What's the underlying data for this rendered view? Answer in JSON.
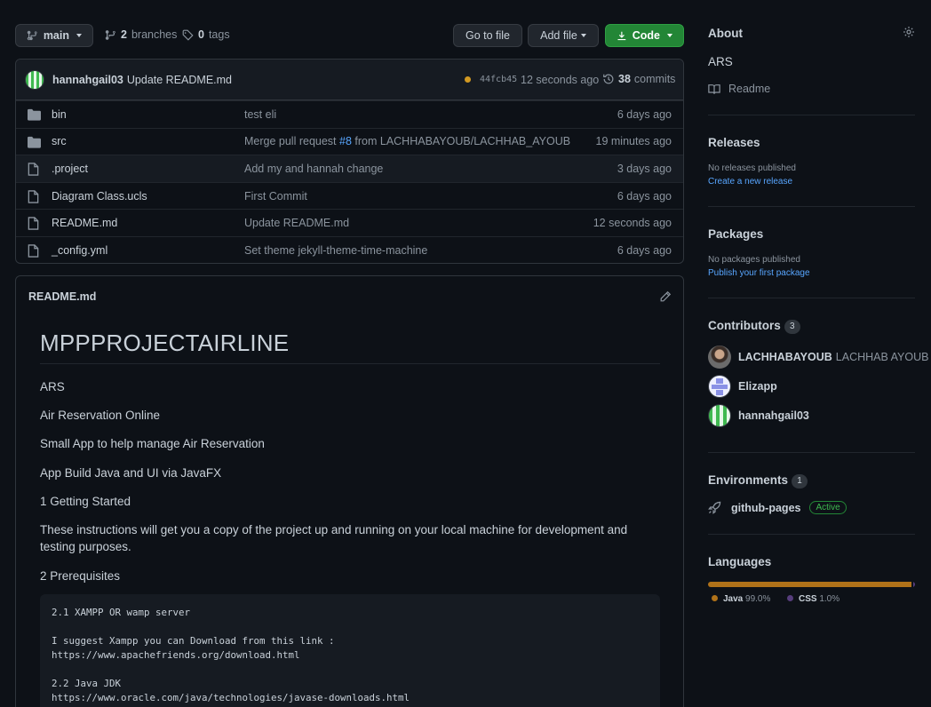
{
  "toolbar": {
    "branch": "main",
    "branches_count": "2",
    "branches_label": "branches",
    "tags_count": "0",
    "tags_label": "tags",
    "go_to_file": "Go to file",
    "add_file": "Add file",
    "code": "Code"
  },
  "latest_commit": {
    "author": "hannahgail03",
    "message": "Update README.md",
    "sha": "44fcb45",
    "time": "12 seconds ago",
    "commits_count": "38",
    "commits_label": "commits",
    "status_color": "#d29922"
  },
  "files": [
    {
      "type": "folder",
      "name": "bin",
      "message": "test eli",
      "age": "6 days ago"
    },
    {
      "type": "folder",
      "name": "src",
      "message_pre": "Merge pull request ",
      "message_link": "#8",
      "message_post": " from LACHHABAYOUB/LACHHAB_AYOUB",
      "age": "19 minutes ago"
    },
    {
      "type": "file",
      "name": ".project",
      "message": "Add my and hannah change",
      "age": "3 days ago"
    },
    {
      "type": "file",
      "name": "Diagram Class.ucls",
      "message": "First Commit",
      "age": "6 days ago"
    },
    {
      "type": "file",
      "name": "README.md",
      "message": "Update README.md",
      "age": "12 seconds ago"
    },
    {
      "type": "file",
      "name": "_config.yml",
      "message": "Set theme jekyll-theme-time-machine",
      "age": "6 days ago"
    }
  ],
  "readme": {
    "filename": "README.md",
    "title": "MPPPROJECTAIRLINE",
    "paragraphs": [
      "ARS",
      "Air Reservation Online",
      "Small App to help manage Air Reservation",
      "App Build Java and UI via JavaFX",
      "1 Getting Started",
      "These instructions will get you a copy of the project up and running on your local machine for development and testing purposes.",
      "2 Prerequisites"
    ],
    "code_lines": [
      "2.1 XAMPP OR wamp server",
      "",
      "I suggest Xampp you can Download from this link :",
      "https://www.apachefriends.org/download.html",
      "",
      "2.2 Java JDK",
      "https://www.oracle.com/java/technologies/javase-downloads.html"
    ]
  },
  "sidebar": {
    "about": {
      "title": "About",
      "description": "ARS",
      "readme_label": "Readme"
    },
    "releases": {
      "title": "Releases",
      "empty": "No releases published",
      "link": "Create a new release"
    },
    "packages": {
      "title": "Packages",
      "empty": "No packages published",
      "link": "Publish your first package"
    },
    "contributors": {
      "title": "Contributors",
      "count": "3",
      "people": [
        {
          "login": "LACHHABAYOUB",
          "name": "LACHHAB AYOUB"
        },
        {
          "login": "Elizapp",
          "name": ""
        },
        {
          "login": "hannahgail03",
          "name": ""
        }
      ]
    },
    "environments": {
      "title": "Environments",
      "count": "1",
      "name": "github-pages",
      "status": "Active"
    },
    "languages": {
      "title": "Languages",
      "items": [
        {
          "name": "Java",
          "percent": "99.0%",
          "value": 99.0,
          "color": "#b07219"
        },
        {
          "name": "CSS",
          "percent": "1.0%",
          "value": 1.0,
          "color": "#563d7c"
        }
      ]
    }
  }
}
